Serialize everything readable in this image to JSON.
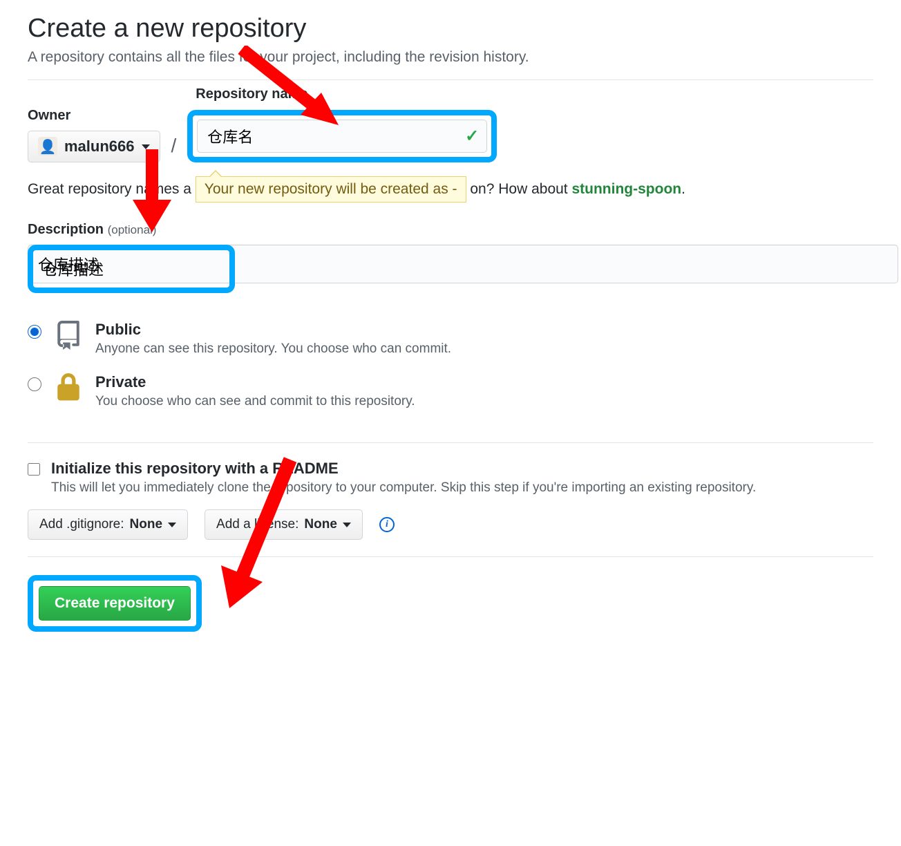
{
  "header": {
    "title": "Create a new repository",
    "subtitle": "A repository contains all the files for your project, including the revision history."
  },
  "owner": {
    "label": "Owner",
    "username": "malun666"
  },
  "repo_name": {
    "label": "Repository name",
    "value": "仓库名"
  },
  "hint": {
    "prefix": "Great repository names a",
    "tooltip": "Your new repository will be created as -",
    "suffix_before": "on? How about ",
    "suggestion": "stunning-spoon",
    "suffix_after": "."
  },
  "description": {
    "label": "Description",
    "optional": "(optional)",
    "value": "仓库描述"
  },
  "visibility": {
    "public": {
      "title": "Public",
      "desc": "Anyone can see this repository. You choose who can commit."
    },
    "private": {
      "title": "Private",
      "desc": "You choose who can see and commit to this repository."
    }
  },
  "readme": {
    "title": "Initialize this repository with a README",
    "desc": "This will let you immediately clone the repository to your computer. Skip this step if you're importing an existing repository."
  },
  "selects": {
    "gitignore_label": "Add .gitignore: ",
    "gitignore_value": "None",
    "license_label": "Add a license: ",
    "license_value": "None"
  },
  "create_button": "Create repository"
}
